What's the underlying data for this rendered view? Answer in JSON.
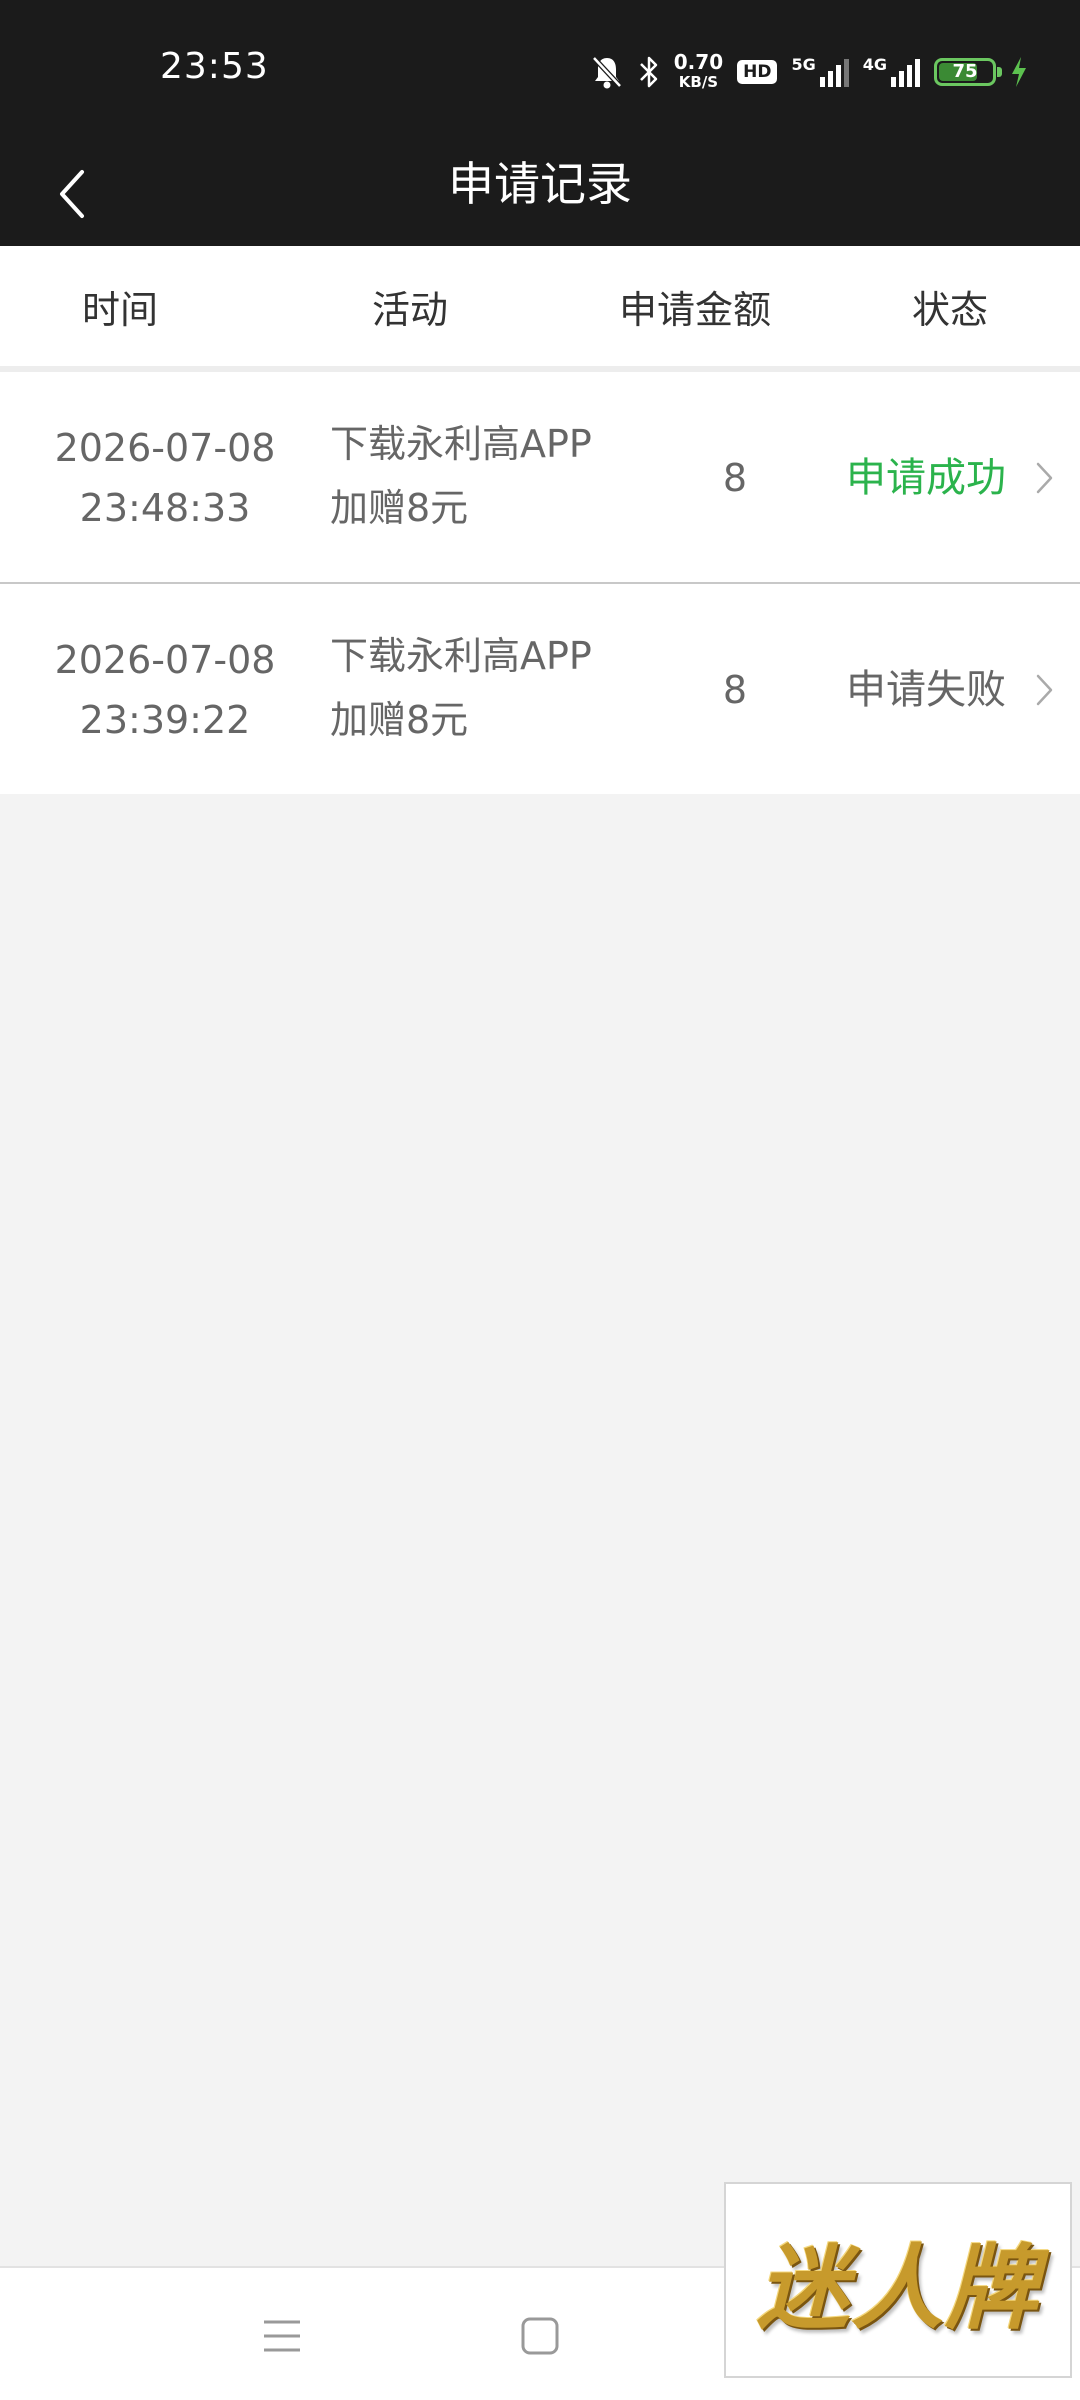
{
  "status_bar": {
    "time": "23:53",
    "net_speed_value": "0.70",
    "net_speed_unit": "KB/S",
    "hd_label": "HD",
    "signal_5g_label": "5G",
    "signal_4g_label": "4G",
    "battery_level": "75",
    "battery_fraction": 0.75,
    "icons": [
      "bell-muted-icon",
      "bluetooth-icon",
      "signal-bars-icon",
      "charging-bolt-icon"
    ]
  },
  "nav": {
    "title": "申请记录",
    "back_icon": "chevron-left-icon"
  },
  "table": {
    "headers": {
      "time": "时间",
      "activity": "活动",
      "amount": "申请金额",
      "status": "状态"
    },
    "records": [
      {
        "date": "2026-07-08",
        "time": "23:48:33",
        "activity_line1": "下载永利高APP",
        "activity_line2": "加赠8元",
        "amount": "8",
        "status": "申请成功"
      },
      {
        "date": "2026-07-08",
        "time": "23:39:22",
        "activity_line1": "下载永利高APP",
        "activity_line2": "加赠8元",
        "amount": "8",
        "status": "申请失败"
      }
    ]
  },
  "colors": {
    "success": "#2bb34c",
    "bar_background": "#1b1b1b",
    "page_background": "#f3f3f3"
  },
  "watermark": {
    "text": "迷人牌"
  }
}
